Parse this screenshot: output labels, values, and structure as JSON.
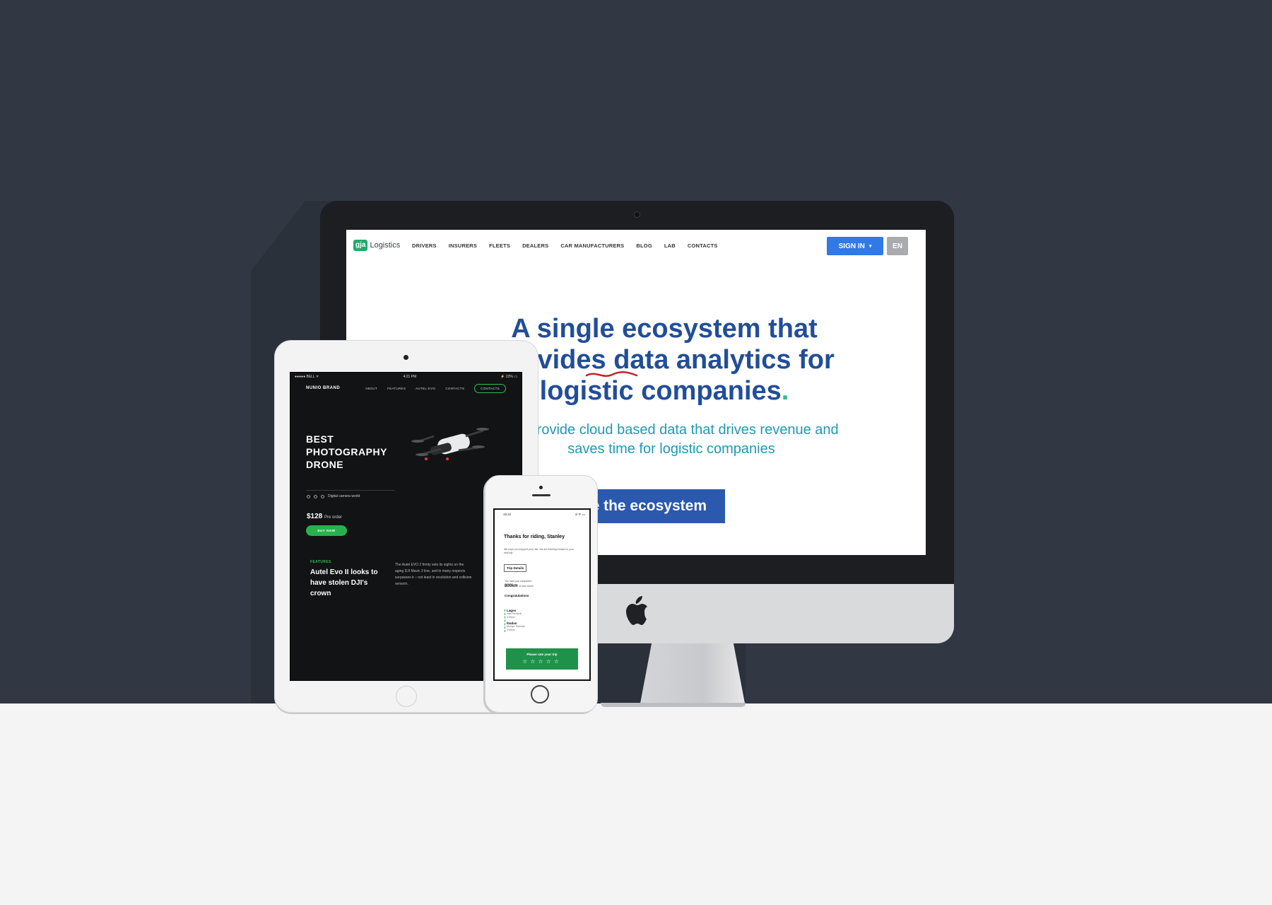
{
  "imac_site": {
    "logo_mark": "gja",
    "logo_text": "Logistics",
    "nav": [
      "DRIVERS",
      "INSURERS",
      "FLEETS",
      "DEALERS",
      "CAR MANUFACTURERS",
      "BLOG",
      "LAB",
      "CONTACTS"
    ],
    "signin_label": "SIGN IN",
    "signin_caret": "▾",
    "lang_label": "EN",
    "hero_title": "A single ecosystem that provides data analytics for logistic companies",
    "hero_title_end": ".",
    "hero_sub": "We provide cloud based data that drives revenue and saves time for logistic companies",
    "cta_label": "Explore the ecosystem",
    "apple_icon": "apple-logo-icon"
  },
  "ipad_site": {
    "status_left": "●●●●● BELL ᯤ",
    "status_center": "4:21 PM",
    "status_right": "⚡ 22% ▭",
    "brand": "NUNIO BRAND",
    "nav": [
      "ABOUT",
      "FEATURES",
      "AUTEL-EVO",
      "CONTACTS"
    ],
    "contact_btn": "CONTACTS",
    "hero": "BEST PHOTOGRAPHY DRONE",
    "tagline": "Digital camera world",
    "price": "$128",
    "price_note": "Pre order",
    "buy_label": "BUY NOW",
    "feature_tag": "FEATURES",
    "feature_title": "Autel Evo II looks to have stolen DJI's crown",
    "feature_body": "The Autel EVO 2 firmly sets its sights on the aging DJI Mavic 2 line, and in many respects surpasses it – not least in resolution and collision sensors."
  },
  "iphone_app": {
    "status_time": "18:42",
    "status_right": "ııl ᯤ ▭",
    "title": "Thanks for riding, Stanley",
    "note": "We hope you enjoyed your ride. We are thinking forward to your next trip.",
    "trip_btn": "Trip Details",
    "done_text": "You have just completed",
    "km_value": "800km",
    "km_note": "of train travel",
    "congrats": "Congratulations",
    "stop1_name": "Lagos",
    "stop1_place": "Iddo Terminal",
    "stop1_time": "9:00pm",
    "stop2_name": "Ibadan",
    "stop2_place": "Moniya Terminal",
    "stop2_time": "3:00pm",
    "rate_label": "Please rate your trip",
    "stars": "☆☆☆☆☆"
  },
  "colors": {
    "backdrop": "#313843",
    "floor": "#f4f4f5",
    "hero_title": "#224e98",
    "hero_sub": "#1e9ab3",
    "cta": "#2a59ad",
    "signin": "#2f7ae5",
    "drone_accent": "#27b14c",
    "rate_green": "#1f9249"
  }
}
